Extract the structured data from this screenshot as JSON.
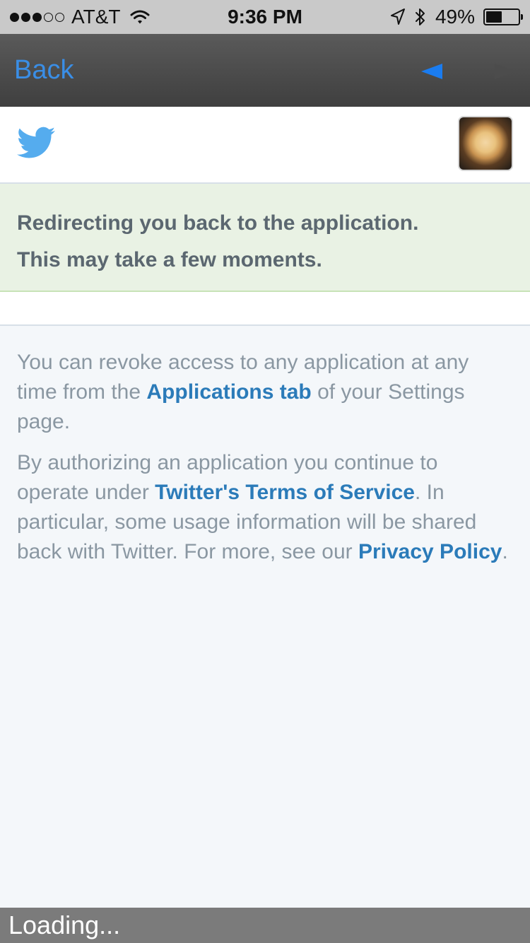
{
  "status_bar": {
    "carrier": "AT&T",
    "time": "9:36 PM",
    "battery_percent": "49%",
    "battery_level": 0.49,
    "signal_filled": 3,
    "signal_total": 5
  },
  "nav": {
    "back_label": "Back",
    "prev_icon": "back-arrow-icon",
    "next_icon": "forward-arrow-icon"
  },
  "notice": {
    "line1": "Redirecting you back to the application.",
    "line2": "This may take a few moments."
  },
  "info": {
    "p1_before": "You can revoke access to any application at any time from the ",
    "p1_link": "Applications tab",
    "p1_after": " of your Settings page.",
    "p2_before": "By authorizing an application you continue to operate under ",
    "p2_link1": "Twitter's Terms of Service",
    "p2_middle": ". In particular, some usage information will be shared back with Twitter. For more, see our ",
    "p2_link2": "Privacy Policy",
    "p2_after": "."
  },
  "loading": {
    "label": "Loading..."
  },
  "colors": {
    "accent": "#2b7bb9",
    "twitter_blue": "#55acee",
    "notice_bg": "#e9f2e4"
  }
}
